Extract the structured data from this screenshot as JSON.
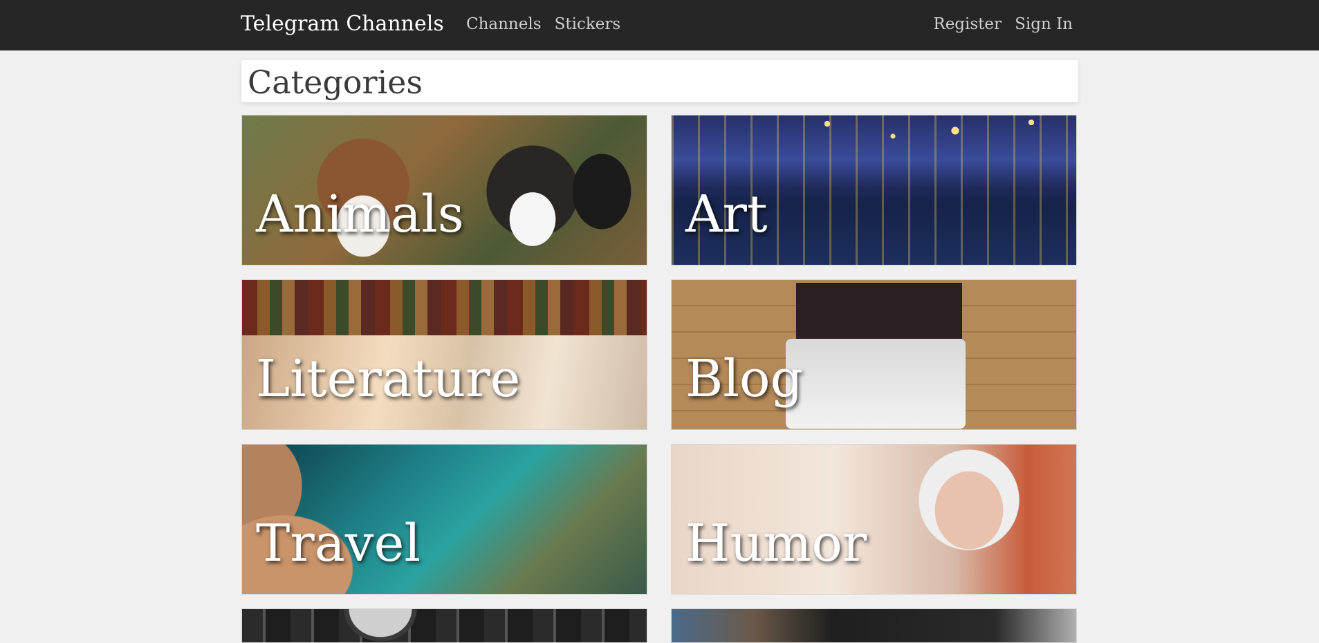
{
  "navbar": {
    "brand": "Telegram Channels",
    "left_links": [
      "Channels",
      "Stickers"
    ],
    "right_links": [
      "Register",
      "Sign In"
    ]
  },
  "page": {
    "title": "Categories"
  },
  "categories": [
    {
      "label": "Animals",
      "image": "dogs-photo"
    },
    {
      "label": "Art",
      "image": "starry-night-painting"
    },
    {
      "label": "Literature",
      "image": "open-book-photo"
    },
    {
      "label": "Blog",
      "image": "laptop-desk-photo"
    },
    {
      "label": "Travel",
      "image": "coastline-water-photo"
    },
    {
      "label": "Humor",
      "image": "smiling-man-phone-photo"
    },
    {
      "label": "",
      "image": "microphone-photo"
    },
    {
      "label": "",
      "image": "bar-drinks-photo"
    }
  ]
}
